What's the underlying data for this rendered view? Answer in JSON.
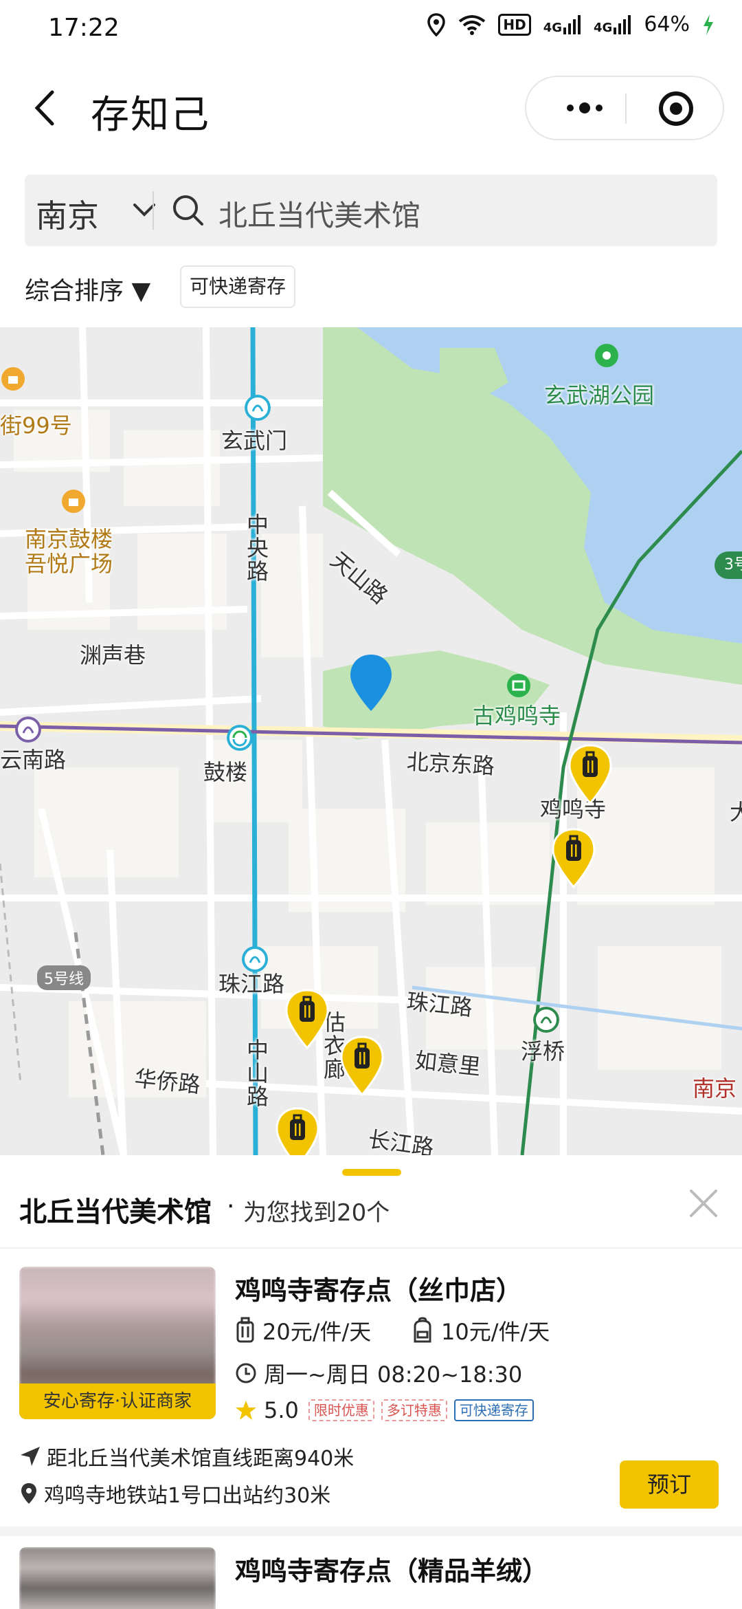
{
  "status_bar": {
    "time": "17:22",
    "battery": "64%",
    "hd": "HD",
    "net1": "4G",
    "net2": "4G"
  },
  "header": {
    "back_label": "back",
    "title": "存知己"
  },
  "search": {
    "city": "南京",
    "query": "北丘当代美术馆"
  },
  "filters": {
    "sort_label": "综合排序 ▼",
    "tag_label": "可快递寄存"
  },
  "map": {
    "labels": {
      "xuanwuhu_park": "玄武湖公园",
      "street99": "街99号",
      "xuanwumen": "玄武门",
      "gulou_mall": "南京鼓楼\n吾悦广场",
      "zhongyang_road": "中央路",
      "tianshan_road": "天山路",
      "yuansheng_lane": "渊声巷",
      "jimingsi_ancient": "古鸡鸣寺",
      "yunnan_road": "云南路",
      "gulou": "鼓楼",
      "beijing_east_road": "北京东路",
      "jimingsi": "鸡鸣寺",
      "line5": "5号线",
      "zhujiang_road_station": "珠江路",
      "zhujiang_road": "珠江路",
      "guyilang": "估衣廊",
      "fuqiao": "浮桥",
      "zhongshan_road": "中山路",
      "huaqiao_road": "华侨路",
      "ruyili": "如意里",
      "changjiang_road": "长江路",
      "nanjing_right": "南京",
      "line3": "3号",
      "da": "大"
    },
    "colors": {
      "lake": "#aed1f2",
      "park": "#bfe3b4",
      "line_blue": "#2ab0d6",
      "line_purple": "#7b5ea8",
      "line_green": "#2e8b4e",
      "pin_blue": "#1b8fe0",
      "marker_yellow": "#f2c400"
    }
  },
  "sheet": {
    "title": "北丘当代美术馆",
    "dot": "·",
    "count_text": "为您找到20个",
    "stores": [
      {
        "name": "鸡鸣寺寄存点（丝巾店）",
        "banner": "安心寄存·认证商家",
        "price_luggage": "20元/件/天",
        "price_bag": "10元/件/天",
        "hours": "周一~周日 08:20~18:30",
        "rating": "5.0",
        "badges": [
          "限时优惠",
          "多订特惠",
          "可快递寄存"
        ],
        "distance": "距北丘当代美术馆直线距离940米",
        "metro": "鸡鸣寺地铁站1号口出站约30米",
        "book_label": "预订"
      },
      {
        "name": "鸡鸣寺寄存点（精品羊绒）"
      }
    ]
  }
}
